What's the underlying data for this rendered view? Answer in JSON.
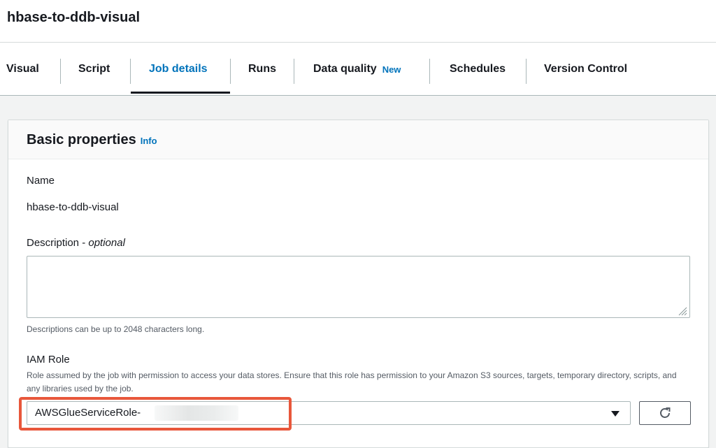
{
  "page": {
    "title": "hbase-to-ddb-visual"
  },
  "tabs": [
    {
      "label": "Visual"
    },
    {
      "label": "Script"
    },
    {
      "label": "Job details"
    },
    {
      "label": "Runs"
    },
    {
      "label": "Data quality",
      "badge": "New"
    },
    {
      "label": "Schedules"
    },
    {
      "label": "Version Control"
    }
  ],
  "active_tab": "Job details",
  "basic_properties": {
    "title": "Basic properties",
    "info_link": "Info",
    "name_label": "Name",
    "name_value": "hbase-to-ddb-visual",
    "description_label": "Description - ",
    "description_optional": "optional",
    "description_value": "",
    "description_hint": "Descriptions can be up to 2048 characters long.",
    "iam_label": "IAM Role",
    "iam_hint": "Role assumed by the job with permission to access your data stores. Ensure that this role has permission to your Amazon S3 sources, targets, temporary directory, scripts, and any libraries used by the job.",
    "iam_selected": "AWSGlueServiceRole-"
  },
  "colors": {
    "accent": "#0073bb",
    "highlight": "#e8573b",
    "background": "#f2f3f3"
  }
}
